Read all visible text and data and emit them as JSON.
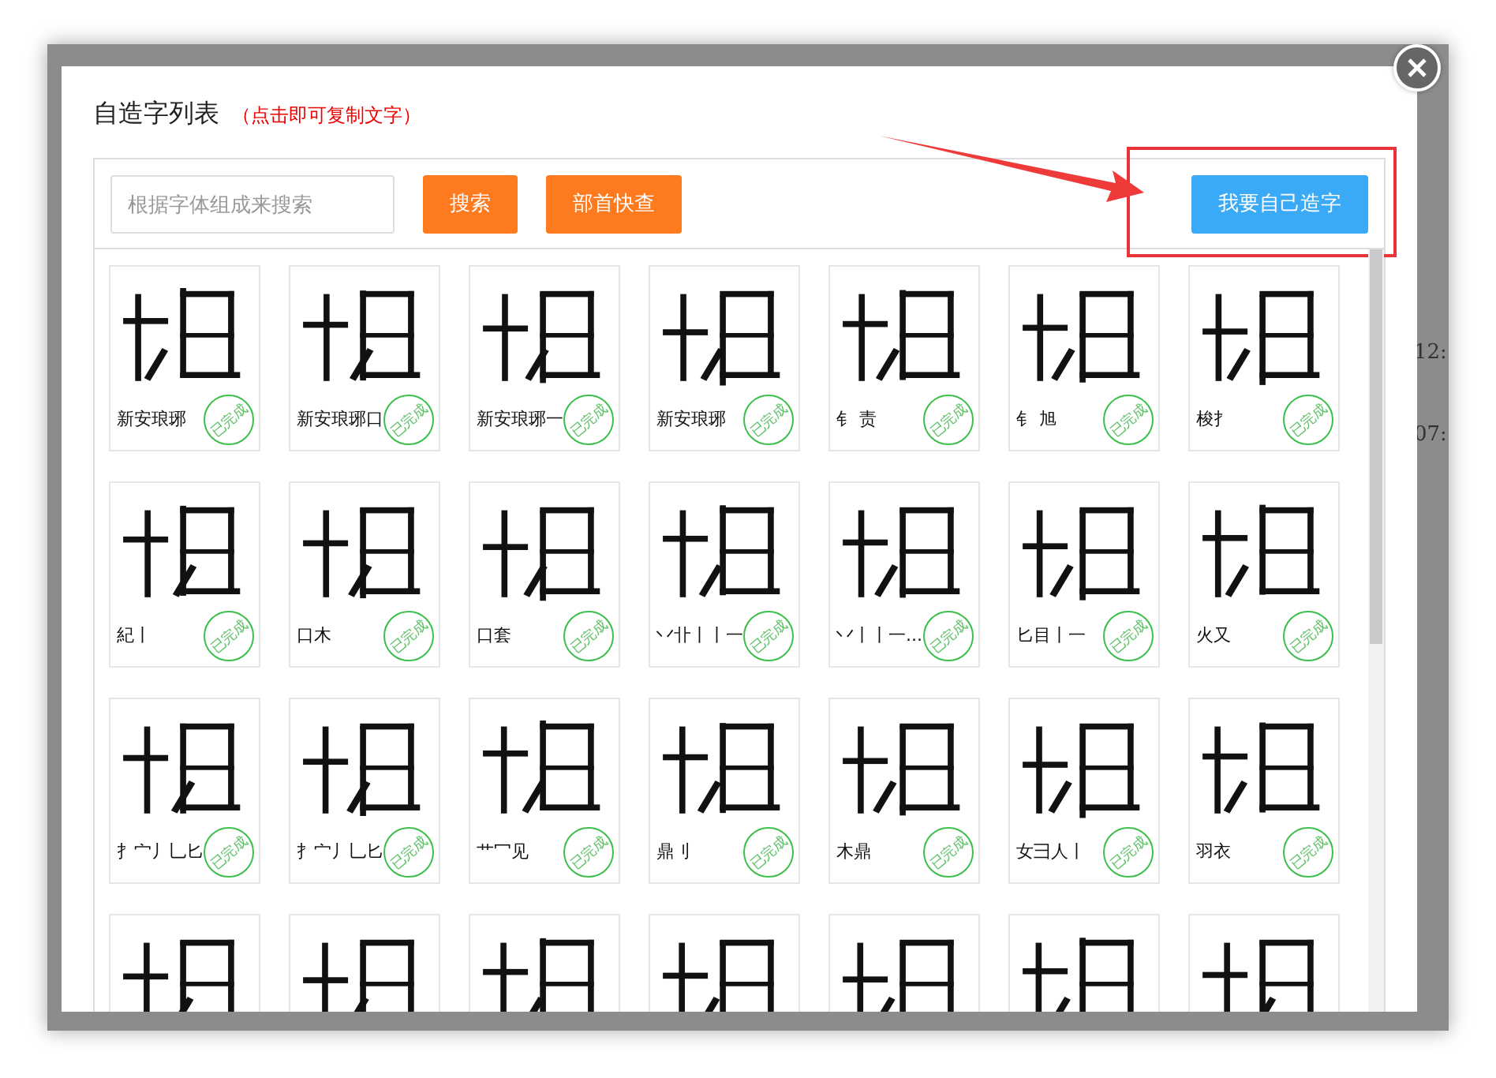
{
  "background_page": {
    "cells": [
      "12:",
      "07:"
    ]
  },
  "dialog": {
    "title": "自造字列表",
    "hint": "（点击即可复制文字）",
    "search": {
      "placeholder": "根据字体组成来搜索"
    },
    "buttons": [
      {
        "label": "搜索",
        "kind": "orange"
      },
      {
        "label": "部首快查",
        "kind": "orange"
      },
      {
        "label": "我要自己造字",
        "kind": "blue"
      }
    ],
    "highlight": {
      "annotated": true
    },
    "characters": [
      {
        "kind": "full",
        "caption": "新安琅琊",
        "status": "已完成"
      },
      {
        "kind": "full",
        "caption": "新安琅琊口",
        "status": "已完成"
      },
      {
        "kind": "full",
        "caption": "新安琅琊一",
        "status": "已完成"
      },
      {
        "kind": "full",
        "caption": "新安琅琊",
        "status": "已完成"
      },
      {
        "kind": "full",
        "caption": "钅 责",
        "status": "已完成"
      },
      {
        "kind": "full",
        "caption": "钅 旭",
        "status": "已完成"
      },
      {
        "kind": "full",
        "caption": "梭扌",
        "status": "已完成"
      },
      {
        "kind": "full",
        "caption": "紀丨",
        "status": "已完成"
      },
      {
        "kind": "full",
        "caption": "口木",
        "status": "已完成"
      },
      {
        "kind": "full",
        "caption": "口套",
        "status": "已完成"
      },
      {
        "kind": "full",
        "caption": "丷卝丨丨一",
        "status": "已完成"
      },
      {
        "kind": "full",
        "caption": "丷丨丨一...",
        "status": "已完成"
      },
      {
        "kind": "full",
        "caption": "匕目丨一",
        "status": "已完成"
      },
      {
        "kind": "full",
        "caption": "火又",
        "status": "已完成"
      },
      {
        "kind": "full",
        "caption": "扌宀丿乚匕",
        "status": "已完成"
      },
      {
        "kind": "full",
        "caption": "扌宀丿乚匕",
        "status": "已完成"
      },
      {
        "kind": "full",
        "caption": "艹冖见",
        "status": "已完成"
      },
      {
        "kind": "full",
        "caption": "鼎刂",
        "status": "已完成"
      },
      {
        "kind": "full",
        "caption": "木鼎",
        "status": "已完成"
      },
      {
        "kind": "full",
        "caption": "女彐人丨",
        "status": "已完成"
      },
      {
        "kind": "full",
        "caption": "羽衣",
        "status": "已完成"
      },
      {
        "kind": "cut"
      },
      {
        "kind": "cut"
      },
      {
        "kind": "cut"
      },
      {
        "kind": "cut"
      },
      {
        "kind": "cut"
      },
      {
        "kind": "cut"
      },
      {
        "kind": "cut"
      }
    ]
  }
}
